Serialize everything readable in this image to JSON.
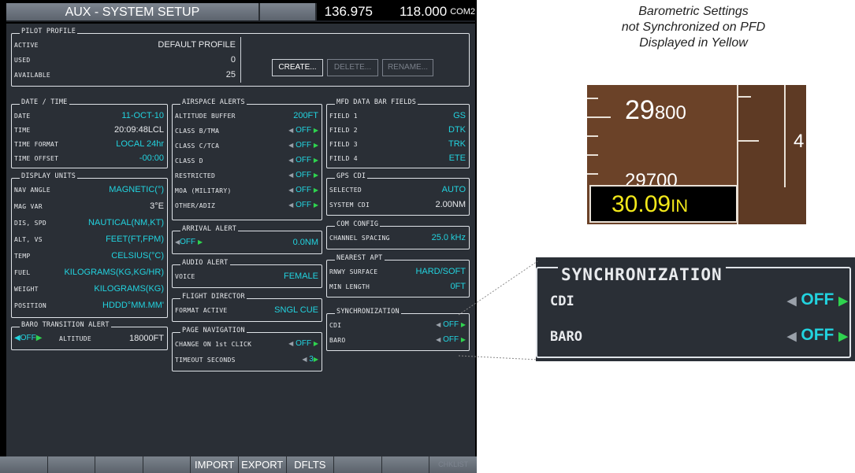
{
  "titlebar": {
    "title": "AUX - SYSTEM SETUP",
    "freq_active": "136.975",
    "freq_standby": "118.000",
    "freq_label": "COM2"
  },
  "pilot_profile": {
    "title": "PILOT PROFILE",
    "rows": [
      {
        "label": "ACTIVE",
        "value": "DEFAULT PROFILE"
      },
      {
        "label": "USED",
        "value": "0"
      },
      {
        "label": "AVAILABLE",
        "value": "25"
      }
    ],
    "buttons": {
      "create": "CREATE...",
      "delete": "DELETE...",
      "rename": "RENAME..."
    }
  },
  "date_time": {
    "title": "DATE / TIME",
    "rows": [
      {
        "label": "DATE",
        "value": "11-OCT-10"
      },
      {
        "label": "TIME",
        "value": "20:09:48LCL"
      },
      {
        "label": "TIME FORMAT",
        "value": "LOCAL 24hr"
      },
      {
        "label": "TIME OFFSET",
        "value": "-00:00"
      }
    ]
  },
  "display_units": {
    "title": "DISPLAY UNITS",
    "rows": [
      {
        "label": "NAV ANGLE",
        "value": "MAGNETIC(°)"
      },
      {
        "label": "MAG VAR",
        "value": "3°E"
      },
      {
        "label": "DIS, SPD",
        "value": "NAUTICAL(NM,KT)"
      },
      {
        "label": "ALT, VS",
        "value": "FEET(FT,FPM)"
      },
      {
        "label": "TEMP",
        "value": "CELSIUS(°C)"
      },
      {
        "label": "FUEL",
        "value": "KILOGRAMS(KG,KG/HR)"
      },
      {
        "label": "WEIGHT",
        "value": "KILOGRAMS(KG)"
      },
      {
        "label": "POSITION",
        "value": "HDDD°MM.MM'"
      }
    ]
  },
  "baro_transition": {
    "title": "BARO TRANSITION ALERT",
    "toggle": "OFF",
    "label": "ALTITUDE",
    "value": "18000FT"
  },
  "airspace_alerts": {
    "title": "AIRSPACE ALERTS",
    "rows": [
      {
        "label": "ALTITUDE BUFFER",
        "value": "200FT"
      },
      {
        "label": "CLASS B/TMA",
        "value": "OFF"
      },
      {
        "label": "CLASS C/TCA",
        "value": "OFF"
      },
      {
        "label": "CLASS D",
        "value": "OFF"
      },
      {
        "label": "RESTRICTED",
        "value": "OFF"
      },
      {
        "label": "MOA (MILITARY)",
        "value": "OFF"
      },
      {
        "label": "OTHER/ADIZ",
        "value": "OFF"
      }
    ]
  },
  "arrival_alert": {
    "title": "ARRIVAL ALERT",
    "toggle": "OFF",
    "value": "0.0NM"
  },
  "audio_alert": {
    "title": "AUDIO ALERT",
    "label": "VOICE",
    "value": "FEMALE"
  },
  "flight_director": {
    "title": "FLIGHT DIRECTOR",
    "label": "FORMAT ACTIVE",
    "value": "SNGL CUE"
  },
  "page_navigation": {
    "title": "PAGE NAVIGATION",
    "rows": [
      {
        "label": "CHANGE ON 1st CLICK",
        "value": "OFF"
      },
      {
        "label": "TIMEOUT SECONDS",
        "value": "3"
      }
    ]
  },
  "mfd_data_bar": {
    "title": "MFD DATA BAR FIELDS",
    "rows": [
      {
        "label": "FIELD 1",
        "value": "GS"
      },
      {
        "label": "FIELD 2",
        "value": "DTK"
      },
      {
        "label": "FIELD 3",
        "value": "TRK"
      },
      {
        "label": "FIELD 4",
        "value": "ETE"
      }
    ]
  },
  "gps_cdi": {
    "title": "GPS CDI",
    "rows": [
      {
        "label": "SELECTED",
        "value": "AUTO"
      },
      {
        "label": "SYSTEM CDI",
        "value": "2.00NM"
      }
    ]
  },
  "com_config": {
    "title": "COM CONFIG",
    "label": "CHANNEL SPACING",
    "value": "25.0 kHz"
  },
  "nearest_apt": {
    "title": "NEAREST APT",
    "rows": [
      {
        "label": "RNWY SURFACE",
        "value": "HARD/SOFT"
      },
      {
        "label": "MIN LENGTH",
        "value": "0FT"
      }
    ]
  },
  "synchronization": {
    "title": "SYNCHRONIZATION",
    "rows": [
      {
        "label": "CDI",
        "value": "OFF"
      },
      {
        "label": "BARO",
        "value": "OFF"
      }
    ]
  },
  "softkeys": [
    "",
    "",
    "",
    "",
    "IMPORT",
    "EXPORT",
    "DFLTS",
    "",
    "",
    "CHKLIST"
  ],
  "annotation": {
    "caption_lines": [
      "Barometric Settings",
      "not Synchronized on PFD",
      "Displayed in Yellow"
    ],
    "pfd": {
      "alt_main": "29",
      "alt_main_small": "800",
      "alt_low": "29700",
      "vs_value": "4",
      "baro_value": "30.09",
      "baro_unit": "IN"
    }
  },
  "colors": {
    "cyan": "#22d3df",
    "green_arrow": "#2fd34f",
    "baro_yellow": "#f2e81a",
    "panel": "#2a2f36"
  }
}
